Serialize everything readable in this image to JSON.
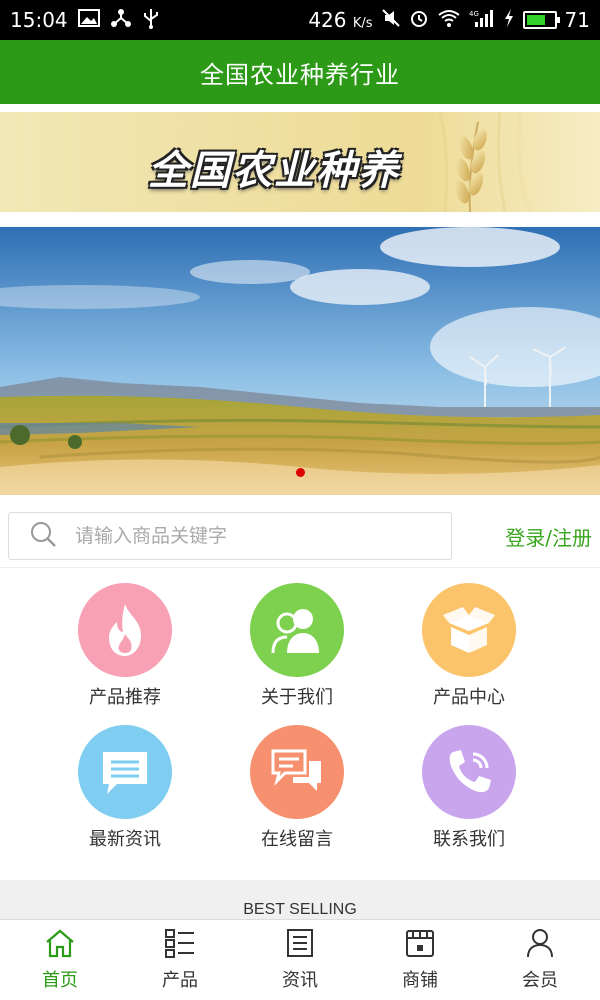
{
  "status_bar": {
    "time": "15:04",
    "speed": "426",
    "speed_unit": "K/s",
    "battery": "71",
    "battery_level": 0.71
  },
  "header": {
    "title": "全国农业种养行业"
  },
  "logo_banner": {
    "text": "全国农业种养"
  },
  "search": {
    "placeholder": "请输入商品关键字",
    "login_label": "登录/注册"
  },
  "menu": [
    {
      "label": "产品推荐",
      "icon": "flame-icon",
      "color": "#f8a0b4"
    },
    {
      "label": "关于我们",
      "icon": "people-icon",
      "color": "#7ed04f"
    },
    {
      "label": "产品中心",
      "icon": "box-icon",
      "color": "#fcc46a"
    },
    {
      "label": "最新资讯",
      "icon": "message-icon",
      "color": "#7fcdf1"
    },
    {
      "label": "在线留言",
      "icon": "chat-icon",
      "color": "#f6906f"
    },
    {
      "label": "联系我们",
      "icon": "phone-icon",
      "color": "#c9a5ee"
    }
  ],
  "section": {
    "best_selling": "BEST SELLING"
  },
  "tabbar": [
    {
      "label": "首页",
      "icon": "home-icon",
      "active": true
    },
    {
      "label": "产品",
      "icon": "list-icon",
      "active": false
    },
    {
      "label": "资讯",
      "icon": "news-icon",
      "active": false
    },
    {
      "label": "商铺",
      "icon": "shop-icon",
      "active": false
    },
    {
      "label": "会员",
      "icon": "user-icon",
      "active": false
    }
  ],
  "colors": {
    "brand": "#2c9a17",
    "accent_red": "#dd0000"
  }
}
